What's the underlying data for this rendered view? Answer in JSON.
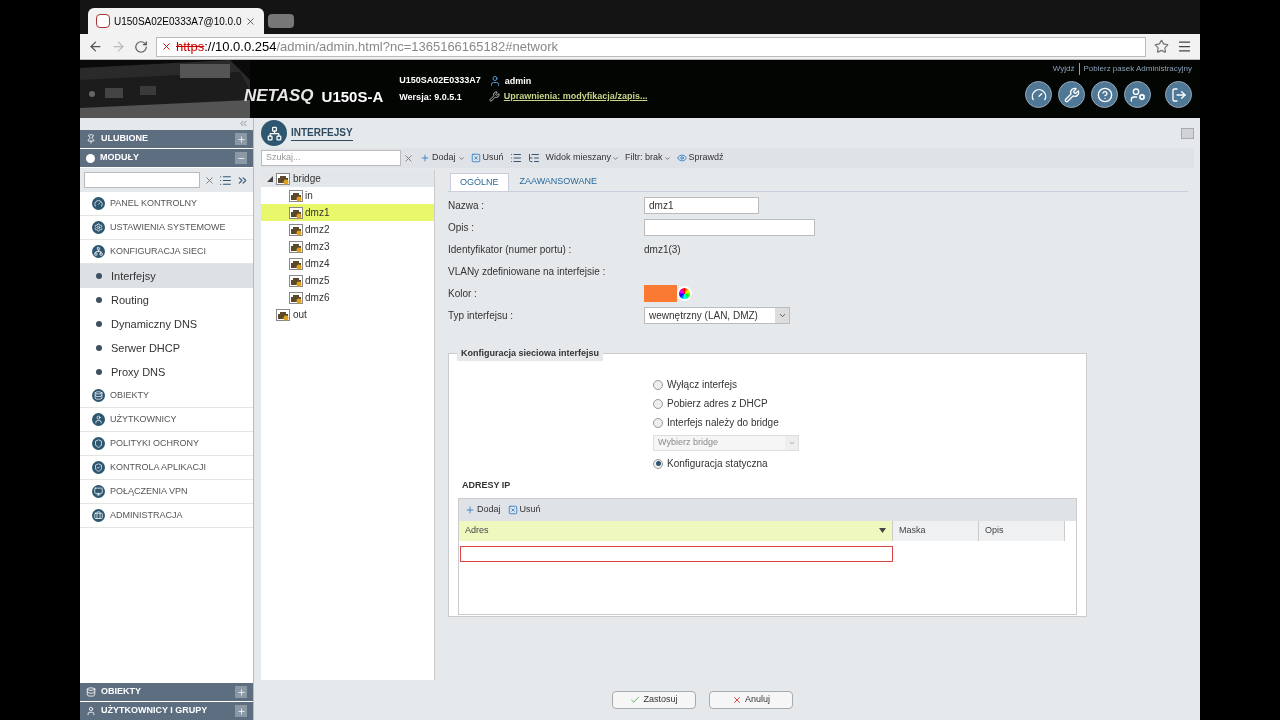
{
  "browser": {
    "tab_title": "U150SA02E0333A7@10.0.0",
    "url": {
      "scheme": "https",
      "host": "://10.0.0.254",
      "path": "/admin/admin.html?nc=1365166165182#network"
    }
  },
  "header": {
    "brand": "NETASQ",
    "model": "U150S-A",
    "serial": "U150SA02E0333A7",
    "version": "Wersja: 9.0.5.1",
    "user": "admin",
    "permissions": "Uprawnienia: modyfikacja/zapis...",
    "links": [
      "Wyjdź",
      "Pobierz pasek Administracyjny"
    ]
  },
  "sidebar": {
    "sections": [
      {
        "label": "ULUBIONE",
        "expanded": false
      },
      {
        "label": "MODUŁY",
        "expanded": true
      }
    ],
    "items": [
      {
        "kind": "module",
        "label": "PANEL KONTROLNY",
        "selected": false
      },
      {
        "kind": "module",
        "label": "USTAWIENIA SYSTEMOWE",
        "selected": false
      },
      {
        "kind": "module",
        "label": "KONFIGURACJA SIECI",
        "selected": false
      },
      {
        "kind": "sub",
        "label": "Interfejsy",
        "selected": true
      },
      {
        "kind": "sub",
        "label": "Routing",
        "selected": false
      },
      {
        "kind": "sub",
        "label": "Dynamiczny DNS",
        "selected": false
      },
      {
        "kind": "sub",
        "label": "Serwer DHCP",
        "selected": false
      },
      {
        "kind": "sub",
        "label": "Proxy DNS",
        "selected": false
      },
      {
        "kind": "module",
        "label": "OBIEKTY",
        "selected": false
      },
      {
        "kind": "module",
        "label": "UŻYTKOWNICY",
        "selected": false
      },
      {
        "kind": "module",
        "label": "POLITYKI OCHRONY",
        "selected": false
      },
      {
        "kind": "module",
        "label": "KONTROLA APLIKACJI",
        "selected": false
      },
      {
        "kind": "module",
        "label": "POŁĄCZENIA VPN",
        "selected": false
      },
      {
        "kind": "module",
        "label": "ADMINISTRACJA",
        "selected": false
      }
    ],
    "bottom": [
      {
        "label": "OBIEKTY"
      },
      {
        "label": "UŻYTKOWNICY I GRUPY"
      }
    ]
  },
  "page": {
    "title": "INTERFEJSY"
  },
  "toolbar": {
    "search_placeholder": "Szukaj...",
    "add": "Dodaj",
    "remove": "Usuń",
    "view": "Widok mieszany",
    "filter": "Filtr: brak",
    "check": "Sprawdź"
  },
  "tree": [
    {
      "label": "bridge",
      "expanded": true,
      "selected": false,
      "children": [
        {
          "label": "in",
          "selected": false
        },
        {
          "label": "dmz1",
          "selected": true
        },
        {
          "label": "dmz2",
          "selected": false
        },
        {
          "label": "dmz3",
          "selected": false
        },
        {
          "label": "dmz4",
          "selected": false
        },
        {
          "label": "dmz5",
          "selected": false
        },
        {
          "label": "dmz6",
          "selected": false
        }
      ]
    },
    {
      "label": "out",
      "selected": false
    }
  ],
  "tabs": [
    {
      "label": "OGÓLNE",
      "selected": true
    },
    {
      "label": "ZAAWANSOWANE",
      "selected": false
    }
  ],
  "fields": [
    {
      "kind": "input",
      "label": "Nazwa :",
      "value": "dmz1"
    },
    {
      "kind": "input",
      "label": "Opis :"
    },
    {
      "kind": "text",
      "label": "Identyfikator (numer portu) :",
      "value": "dmz1(3)"
    },
    {
      "kind": "text",
      "label": "VLANy zdefiniowane na interfejsie :"
    },
    {
      "kind": "color",
      "label": "Kolor :",
      "color": "#fb7a32"
    },
    {
      "kind": "select",
      "label": "Typ interfejsu :",
      "value": "wewnętrzny (LAN, DMZ)"
    }
  ],
  "network": {
    "legend": "Konfiguracja sieciowa interfejsu",
    "options": [
      {
        "label": "Wyłącz interfejs",
        "selected": false
      },
      {
        "label": "Pobierz adres z DHCP",
        "selected": false
      },
      {
        "label": "Interfejs należy do bridge",
        "selected": false
      },
      {
        "label": "Konfiguracja statyczna",
        "selected": true
      }
    ],
    "bridge_placeholder": "Wybierz bridge",
    "bridge_disabled": true
  },
  "ip": {
    "title": "ADRESY IP",
    "add": "Dodaj",
    "remove": "Usuń",
    "columns": [
      {
        "label": "Adres",
        "sorted": true
      },
      {
        "label": "Maska",
        "sorted": false
      },
      {
        "label": "Opis",
        "sorted": false
      }
    ]
  },
  "footer": {
    "apply": "Zastosuj",
    "cancel": "Anuluj"
  }
}
